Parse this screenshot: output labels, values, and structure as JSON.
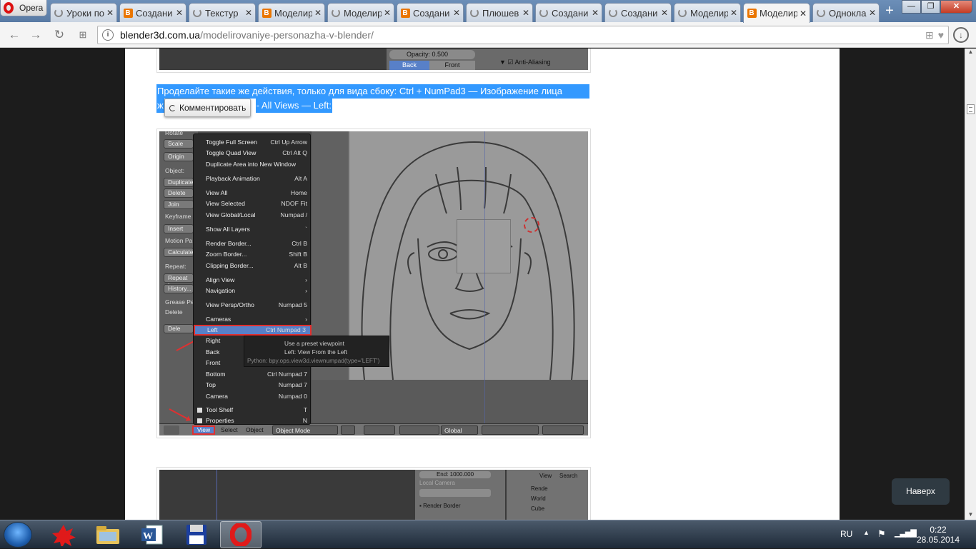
{
  "browser": {
    "menu_label": "Opera",
    "tabs": [
      {
        "label": "Уроки по",
        "icon": "loading-icon",
        "active": false
      },
      {
        "label": "Создани",
        "icon": "blender-icon",
        "active": false
      },
      {
        "label": "Текстур",
        "icon": "loading-icon",
        "active": false
      },
      {
        "label": "Моделир",
        "icon": "blender-icon",
        "active": false
      },
      {
        "label": "Моделир",
        "icon": "loading-icon",
        "active": false
      },
      {
        "label": "Создани",
        "icon": "blender-icon",
        "active": false
      },
      {
        "label": "Плюшев",
        "icon": "loading-icon",
        "active": false
      },
      {
        "label": "Создани",
        "icon": "loading-icon",
        "active": false
      },
      {
        "label": "Создани",
        "icon": "loading-icon",
        "active": false
      },
      {
        "label": "Моделир",
        "icon": "loading-icon",
        "active": false
      },
      {
        "label": "Моделир",
        "icon": "blender-icon",
        "active": true
      },
      {
        "label": "Одноклас",
        "icon": "loading-icon",
        "active": false
      }
    ],
    "url_domain": "blender3d.com.ua",
    "url_path": "/modelirovaniye-personazha-v-blender/"
  },
  "article": {
    "shot1": {
      "opacity_label": "Opacity: 0.500",
      "back": "Back",
      "front": "Front",
      "anti_aliasing": "Anti-Aliasing"
    },
    "selected_line1": "Проделайте такие же действия, только для вида сбоку: Ctrl + NumPad3 — Изображение лица",
    "selected_line2_start": "ж",
    "selected_line2_end": "- All Views — Left:",
    "comment_button": "Комментировать",
    "blender": {
      "left_panel": [
        "Rotate",
        "Scale",
        "Origin",
        "Object:",
        "Duplicate",
        "Delete",
        "Join",
        "Keyframe",
        "Insert",
        "Motion Pa",
        "Calculate",
        "Repeat:",
        "Repeat La",
        "History...",
        "Grease Pe",
        "Delete",
        "Dele"
      ],
      "menu": [
        {
          "label": "Toggle Full Screen",
          "shortcut": "Ctrl Up Arrow"
        },
        {
          "label": "Toggle Quad View",
          "shortcut": "Ctrl Alt Q"
        },
        {
          "label": "Duplicate Area into New Window",
          "shortcut": ""
        },
        {
          "label": "Playback Animation",
          "shortcut": "Alt A"
        },
        {
          "label": "View All",
          "shortcut": "Home"
        },
        {
          "label": "View Selected",
          "shortcut": "NDOF Fit"
        },
        {
          "label": "View Global/Local",
          "shortcut": "Numpad /"
        },
        {
          "label": "Show All Layers",
          "shortcut": "`"
        },
        {
          "label": "Render Border...",
          "shortcut": "Ctrl B"
        },
        {
          "label": "Zoom Border...",
          "shortcut": "Shift B"
        },
        {
          "label": "Clipping Border...",
          "shortcut": "Alt B"
        },
        {
          "label": "Align View",
          "shortcut": "›"
        },
        {
          "label": "Navigation",
          "shortcut": "›"
        },
        {
          "label": "View Persp/Ortho",
          "shortcut": "Numpad 5"
        },
        {
          "label": "Cameras",
          "shortcut": "›"
        },
        {
          "label": "Left",
          "shortcut": "Ctrl Numpad 3",
          "highlight": true
        },
        {
          "label": "Right",
          "shortcut": ""
        },
        {
          "label": "Back",
          "shortcut": ""
        },
        {
          "label": "Front",
          "shortcut": ""
        },
        {
          "label": "Bottom",
          "shortcut": "Ctrl Numpad 7"
        },
        {
          "label": "Top",
          "shortcut": "Numpad 7"
        },
        {
          "label": "Camera",
          "shortcut": "Numpad 0"
        },
        {
          "label": "Tool Shelf",
          "shortcut": "T",
          "check": true
        },
        {
          "label": "Properties",
          "shortcut": "N",
          "check": true
        }
      ],
      "tooltip": {
        "line1": "Use a preset viewpoint",
        "line2": "Left: View From the Left",
        "python": "Python: bpy.ops.view3d.viewnumpad(type='LEFT')"
      },
      "header": {
        "view": "View",
        "select": "Select",
        "object": "Object",
        "mode": "Object Mode",
        "orientation": "Global"
      }
    },
    "shot3": {
      "end_label": "End: 1000.000",
      "local_camera": "Local Camera",
      "render_border": "Render Border",
      "view": "View",
      "search": "Search",
      "outliner": [
        "Rende",
        "World",
        "Cube"
      ]
    }
  },
  "back_to_top": "Наверх",
  "taskbar": {
    "apps": [
      {
        "name": "game-app-icon",
        "active": false
      },
      {
        "name": "explorer-icon",
        "active": false
      },
      {
        "name": "word-icon",
        "active": false
      },
      {
        "name": "save-app-icon",
        "active": false
      },
      {
        "name": "opera-icon",
        "active": true
      }
    ],
    "lang": "RU",
    "time": "0:22",
    "date": "28.05.2014"
  }
}
